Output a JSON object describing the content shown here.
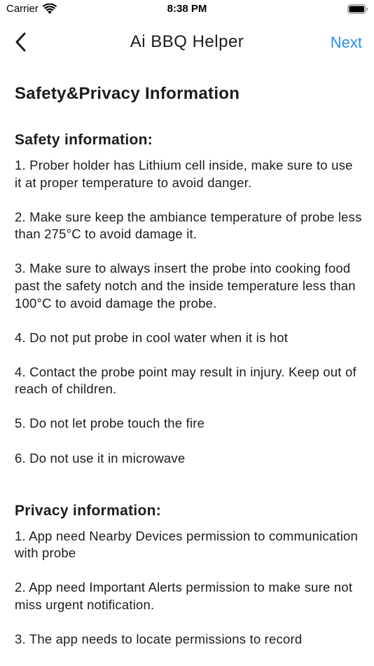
{
  "status_bar": {
    "carrier": "Carrier",
    "time": "8:38 PM"
  },
  "nav": {
    "title": "Ai BBQ Helper",
    "next_label": "Next",
    "accent_color": "#2f8df0"
  },
  "content": {
    "page_heading": "Safety&Privacy Information",
    "safety": {
      "heading": "Safety information:",
      "items": [
        "1. Prober holder has Lithium cell inside, make sure to use it at proper temperature to avoid danger.",
        "2. Make sure keep the ambiance temperature of probe less than 275°C to avoid damage it.",
        "3. Make sure to always insert the probe into cooking food past the safety notch and the inside temperature less than 100°C to avoid damage the probe.",
        "4. Do not put probe in cool water when it is hot",
        "4. Contact the probe point may result in injury. Keep out of reach of children.",
        "5. Do not let probe touch the fire",
        "6. Do not use it in microwave"
      ]
    },
    "privacy": {
      "heading": "Privacy information:",
      "items": [
        "1. App need Nearby Devices permission to communication with probe",
        "2. App need Important Alerts permission to make sure not miss urgent notification.",
        "3. The app needs to locate permissions to record"
      ]
    }
  }
}
